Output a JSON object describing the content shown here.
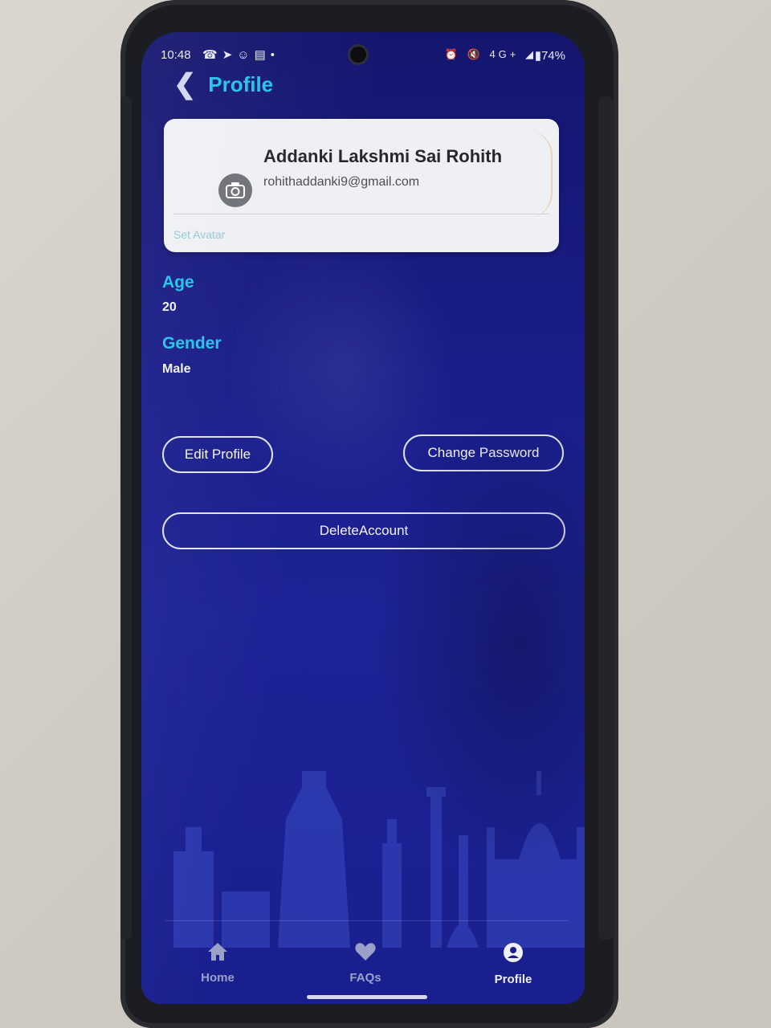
{
  "status_bar": {
    "time": "10:48",
    "battery": "74%",
    "network": "4G+",
    "left_icons": [
      "whatsapp-icon",
      "telegram-icon",
      "snapchat-icon",
      "notes-icon"
    ],
    "right_icons": [
      "alarm-icon",
      "mute-icon",
      "volte-icon",
      "signal-icon",
      "battery-icon"
    ]
  },
  "header": {
    "title": "Profile",
    "back_icon": "chevron-left-icon"
  },
  "profile_card": {
    "name": "Addanki Lakshmi Sai Rohith",
    "email": "rohithaddanki9@gmail.com",
    "set_avatar_label": "Set Avatar",
    "avatar_icon": "camera-icon"
  },
  "fields": {
    "age_label": "Age",
    "age_value": "20",
    "gender_label": "Gender",
    "gender_value": "Male"
  },
  "actions": {
    "edit_profile": "Edit Profile",
    "change_password": "Change Password",
    "delete_account": "DeleteAccount"
  },
  "nav": {
    "items": [
      {
        "label": "Home",
        "icon": "home-icon",
        "active": false
      },
      {
        "label": "FAQs",
        "icon": "heart-icon",
        "active": false
      },
      {
        "label": "Profile",
        "icon": "user-icon",
        "active": true
      }
    ]
  },
  "colors": {
    "accent": "#22c4e8",
    "background": "#1a1d8a",
    "card": "#eef0f4"
  }
}
